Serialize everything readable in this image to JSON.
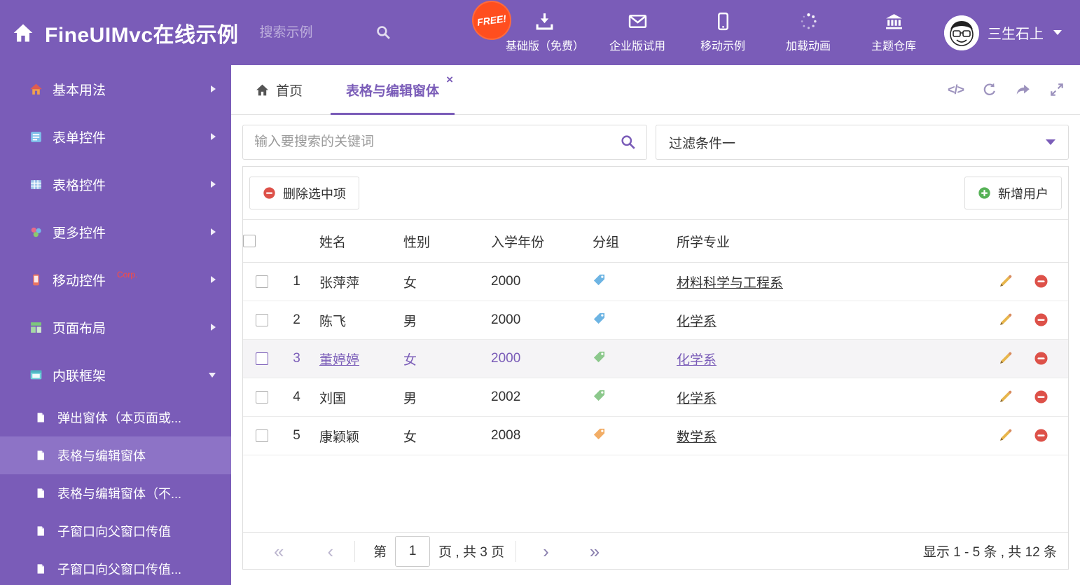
{
  "colors": {
    "theme_purple": "#7a5cb8",
    "sidebar_selected": "#8d73c6",
    "free_badge_bg": "#ff4e1f",
    "delete_red": "#dd5149",
    "add_green": "#57b257",
    "pencil_yellow": "#e8b64c"
  },
  "header": {
    "title": "FineUIMvc在线示例",
    "search_placeholder": "搜索示例",
    "free_badge": "FREE!",
    "nav": [
      {
        "label": "基础版（免费）"
      },
      {
        "label": "企业版试用"
      },
      {
        "label": "移动示例"
      },
      {
        "label": "加载动画"
      },
      {
        "label": "主题仓库"
      }
    ],
    "user_name": "三生石上"
  },
  "sidebar": {
    "items": [
      {
        "label": "基本用法"
      },
      {
        "label": "表单控件"
      },
      {
        "label": "表格控件"
      },
      {
        "label": "更多控件"
      },
      {
        "label": "移动控件",
        "badge": "Corp."
      },
      {
        "label": "页面布局"
      },
      {
        "label": "内联框架"
      }
    ],
    "subitems": [
      {
        "label": "弹出窗体（本页面或..."
      },
      {
        "label": "表格与编辑窗体"
      },
      {
        "label": "表格与编辑窗体（不..."
      },
      {
        "label": "子窗口向父窗口传值"
      },
      {
        "label": "子窗口向父窗口传值..."
      }
    ]
  },
  "tabs": {
    "home": "首页",
    "active": "表格与编辑窗体",
    "close": "×",
    "code_tool": "</>"
  },
  "filters": {
    "search_placeholder": "输入要搜索的关键词",
    "filter_selected": "过滤条件一"
  },
  "toolbar": {
    "delete_label": "删除选中项",
    "add_label": "新增用户"
  },
  "table": {
    "columns": [
      "姓名",
      "性别",
      "入学年份",
      "分组",
      "所学专业"
    ],
    "rows": [
      {
        "num": "1",
        "name": "张萍萍",
        "gender": "女",
        "year": "2000",
        "tag_color": "#6db4e3",
        "major": "材料科学与工程系"
      },
      {
        "num": "2",
        "name": "陈飞",
        "gender": "男",
        "year": "2000",
        "tag_color": "#6db4e3",
        "major": "化学系"
      },
      {
        "num": "3",
        "name": "董婷婷",
        "gender": "女",
        "year": "2000",
        "tag_color": "#8cc88c",
        "major": "化学系"
      },
      {
        "num": "4",
        "name": "刘国",
        "gender": "男",
        "year": "2002",
        "tag_color": "#8cc88c",
        "major": "化学系"
      },
      {
        "num": "5",
        "name": "康颖颖",
        "gender": "女",
        "year": "2008",
        "tag_color": "#f2ad66",
        "major": "数学系"
      }
    ]
  },
  "pagination": {
    "first": "«",
    "prev": "‹",
    "prefix": "第",
    "page": "1",
    "suffix": "页 , 共 3 页",
    "next": "›",
    "last": "»",
    "summary": "显示 1 - 5 条 , 共 12 条"
  }
}
